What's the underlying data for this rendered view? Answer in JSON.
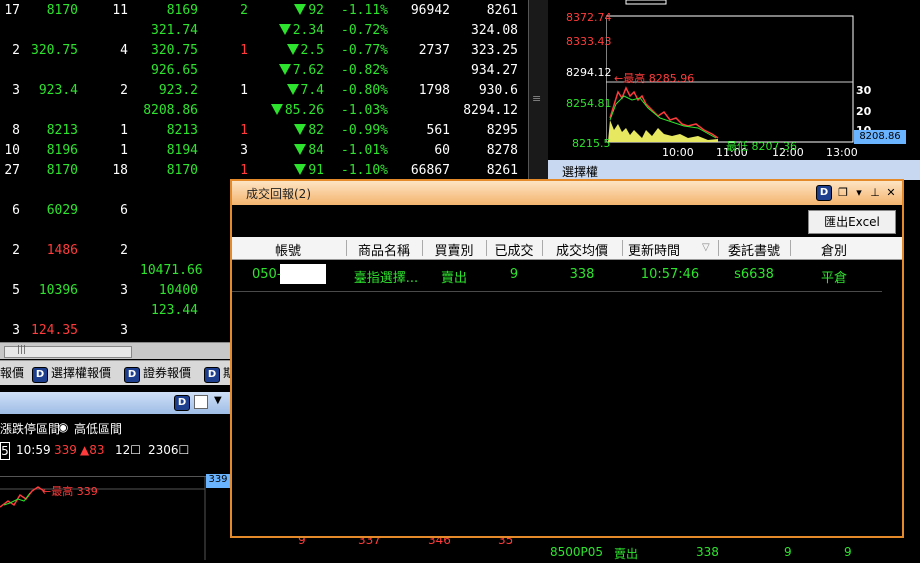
{
  "quote_rows": [
    {
      "c1": "17",
      "c2": "8170",
      "c2color": "#2ee32e",
      "c3": "11",
      "c4": "8169",
      "c4color": "#2ee32e",
      "c5": "2",
      "c5color": "#2ee32e",
      "c6": "92",
      "c7": "-1.11%",
      "c8": "96942",
      "c9": "8261"
    },
    {
      "c1": "",
      "c2": "",
      "c3": "",
      "c4": "321.74",
      "c4color": "#2ee32e",
      "c5": "",
      "c6": "2.34",
      "c7": "-0.72%",
      "c8": "",
      "c9": "324.08"
    },
    {
      "c1": "2",
      "c2": "320.75",
      "c2color": "#2ee32e",
      "c3": "4",
      "c4": "320.75",
      "c4color": "#2ee32e",
      "c5": "1",
      "c5color": "#ff3b3b",
      "c6": "2.5",
      "c7": "-0.77%",
      "c8": "2737",
      "c9": "323.25"
    },
    {
      "c1": "",
      "c2": "",
      "c3": "",
      "c4": "926.65",
      "c4color": "#2ee32e",
      "c5": "",
      "c6": "7.62",
      "c7": "-0.82%",
      "c8": "",
      "c9": "934.27"
    },
    {
      "c1": "3",
      "c2": "923.4",
      "c2color": "#2ee32e",
      "c3": "2",
      "c4": "923.2",
      "c4color": "#2ee32e",
      "c5": "1",
      "c5color": "#fff",
      "c6": "7.4",
      "c7": "-0.80%",
      "c8": "1798",
      "c9": "930.6"
    },
    {
      "c1": "",
      "c2": "",
      "c3": "",
      "c4": "8208.86",
      "c4color": "#2ee32e",
      "c5": "",
      "c6": "85.26",
      "c7": "-1.03%",
      "c8": "",
      "c9": "8294.12"
    },
    {
      "c1": "8",
      "c2": "8213",
      "c2color": "#2ee32e",
      "c3": "1",
      "c4": "8213",
      "c4color": "#2ee32e",
      "c5": "1",
      "c5color": "#ff3b3b",
      "c6": "82",
      "c7": "-0.99%",
      "c8": "561",
      "c9": "8295"
    },
    {
      "c1": "10",
      "c2": "8196",
      "c2color": "#2ee32e",
      "c3": "1",
      "c4": "8194",
      "c4color": "#2ee32e",
      "c5": "3",
      "c5color": "#fff",
      "c6": "84",
      "c7": "-1.01%",
      "c8": "60",
      "c9": "8278"
    },
    {
      "c1": "27",
      "c2": "8170",
      "c2color": "#2ee32e",
      "c3": "18",
      "c4": "8170",
      "c4color": "#2ee32e",
      "c5": "1",
      "c5color": "#ff3b3b",
      "c6": "91",
      "c7": "-1.10%",
      "c8": "66867",
      "c9": "8261"
    },
    {
      "c1": "",
      "c2": "",
      "c3": "",
      "c4": "",
      "c5": "",
      "c6": "",
      "c7": "",
      "c8": "",
      "c9": ""
    },
    {
      "c1": "6",
      "c2": "6029",
      "c2color": "#2ee32e",
      "c3": "6",
      "c4": "",
      "c5": "",
      "c6": "",
      "c7": "",
      "c8": "",
      "c9": ""
    },
    {
      "c1": "",
      "c2": "",
      "c3": "",
      "c4": "",
      "c5": "",
      "c6": "",
      "c7": "",
      "c8": "",
      "c9": ""
    },
    {
      "c1": "2",
      "c2": "1486",
      "c2color": "#ff3b3b",
      "c3": "2",
      "c4": "",
      "c5": "",
      "c6": "",
      "c7": "",
      "c8": "",
      "c9": ""
    },
    {
      "c1": "",
      "c2": "",
      "c3": "",
      "c4": "10471.66",
      "c4color": "#2ee32e",
      "c5": "",
      "c6": "",
      "c7": "",
      "c8": "",
      "c9": ""
    },
    {
      "c1": "5",
      "c2": "10396",
      "c2color": "#2ee32e",
      "c3": "3",
      "c4": "10400",
      "c4color": "#2ee32e",
      "c5": "",
      "c6": "",
      "c7": "",
      "c8": "",
      "c9": ""
    },
    {
      "c1": "",
      "c2": "",
      "c3": "",
      "c4": "123.44",
      "c4color": "#2ee32e",
      "c5": "",
      "c6": "",
      "c7": "",
      "c8": "",
      "c9": ""
    },
    {
      "c1": "3",
      "c2": "124.35",
      "c2color": "#ff3b3b",
      "c3": "3",
      "c4": "",
      "c5": "",
      "c6": "",
      "c7": "",
      "c8": "",
      "c9": ""
    }
  ],
  "tabs": [
    {
      "label": "報價",
      "has_logo": false
    },
    {
      "label": "選擇權報價",
      "has_logo": true
    },
    {
      "label": "證券報價",
      "has_logo": true
    },
    {
      "label": "期",
      "has_logo": true
    }
  ],
  "panel2": {
    "radio1_label": "漲跌停區間",
    "radio2_label": "高低區間",
    "box_value": "5",
    "time": "10:59",
    "price": "339",
    "change": "▲83",
    "count1": "12☐",
    "count2": "2306☐",
    "high_label": "←最高 339",
    "price_tag": "339"
  },
  "right_chart": {
    "y_labels": [
      "8372.74",
      "8333.43",
      "8294.12",
      "8254.81",
      "8215.5"
    ],
    "x_labels": [
      "10:00",
      "11:00",
      "12:00",
      "13:00"
    ],
    "vol_labels": [
      "30",
      "20",
      "10"
    ],
    "high_note": "←最高 8285.96",
    "low_note": "最低 8207.36",
    "price_tag": "8208.86"
  },
  "right_panel2_title": "選擇權",
  "bottom_strip": {
    "cells": [
      "9",
      "337",
      "346",
      "35"
    ],
    "right_cells": [
      "8500P05",
      "賣出",
      "338",
      "9",
      "9"
    ]
  },
  "dialog": {
    "title": "成交回報(2)",
    "export_label": "匯出Excel",
    "columns": [
      "帳號",
      "商品名稱",
      "買賣別",
      "已成交",
      "成交均價",
      "更新時間",
      "委託書號",
      "倉別"
    ],
    "sort_arrow": "▽",
    "rows": [
      {
        "account_prefix": "050-",
        "product": "臺指選擇...",
        "side": "賣出",
        "filled": "9",
        "avg_price": "338",
        "time": "10:57:46",
        "order_no": "s6638",
        "position": "平倉"
      }
    ]
  },
  "colors": {
    "up": "#ff3b3b",
    "down": "#2ee32e",
    "dialog_border": "#e48a2a"
  }
}
